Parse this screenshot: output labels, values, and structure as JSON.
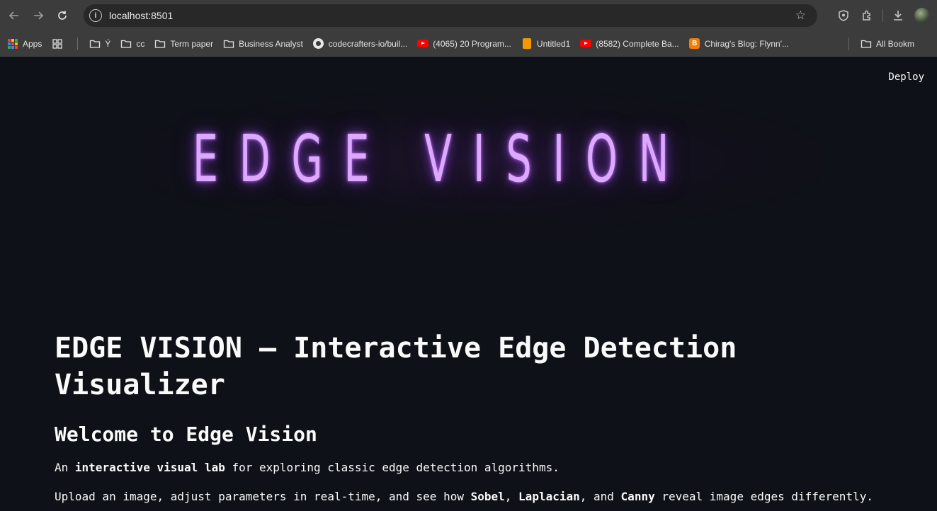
{
  "browser": {
    "url": "localhost:8501",
    "bookmarks": [
      {
        "label": "Apps",
        "icon": "apps-icon"
      },
      {
        "label": "Ý",
        "icon": "folder-icon"
      },
      {
        "label": "cc",
        "icon": "folder-icon"
      },
      {
        "label": "Term paper",
        "icon": "folder-icon"
      },
      {
        "label": "Business Analyst",
        "icon": "folder-icon"
      },
      {
        "label": "codecrafters-io/buil...",
        "icon": "github-icon"
      },
      {
        "label": "(4065) 20 Program...",
        "icon": "youtube-icon"
      },
      {
        "label": "Untitled1",
        "icon": "notebook-icon"
      },
      {
        "label": "(8582) Complete Ba...",
        "icon": "youtube-icon"
      },
      {
        "label": "Chirag's Blog: Flynn'...",
        "icon": "blogger-icon"
      },
      {
        "label": "All Bookm",
        "icon": "folder-icon"
      }
    ]
  },
  "app": {
    "deploy_label": "Deploy",
    "hero_title": "EDGE VISION",
    "main_title": "EDGE VISION — Interactive Edge Detection Visualizer",
    "welcome_heading": "Welcome to Edge Vision",
    "intro": {
      "pre": "An ",
      "bold": "interactive visual lab",
      "post": " for exploring classic edge detection algorithms."
    },
    "upload_line": {
      "t1": "Upload an image, adjust parameters in real-time, and see how ",
      "b1": "Sobel",
      "t2": ", ",
      "b2": "Laplacian",
      "t3": ", and ",
      "b3": "Canny",
      "t4": " reveal image edges differently."
    }
  },
  "colors": {
    "app_background": "#0e1117",
    "neon_text": "#dca9ff",
    "neon_glow": "#aa50ff",
    "chrome": "#3c3c3c"
  }
}
